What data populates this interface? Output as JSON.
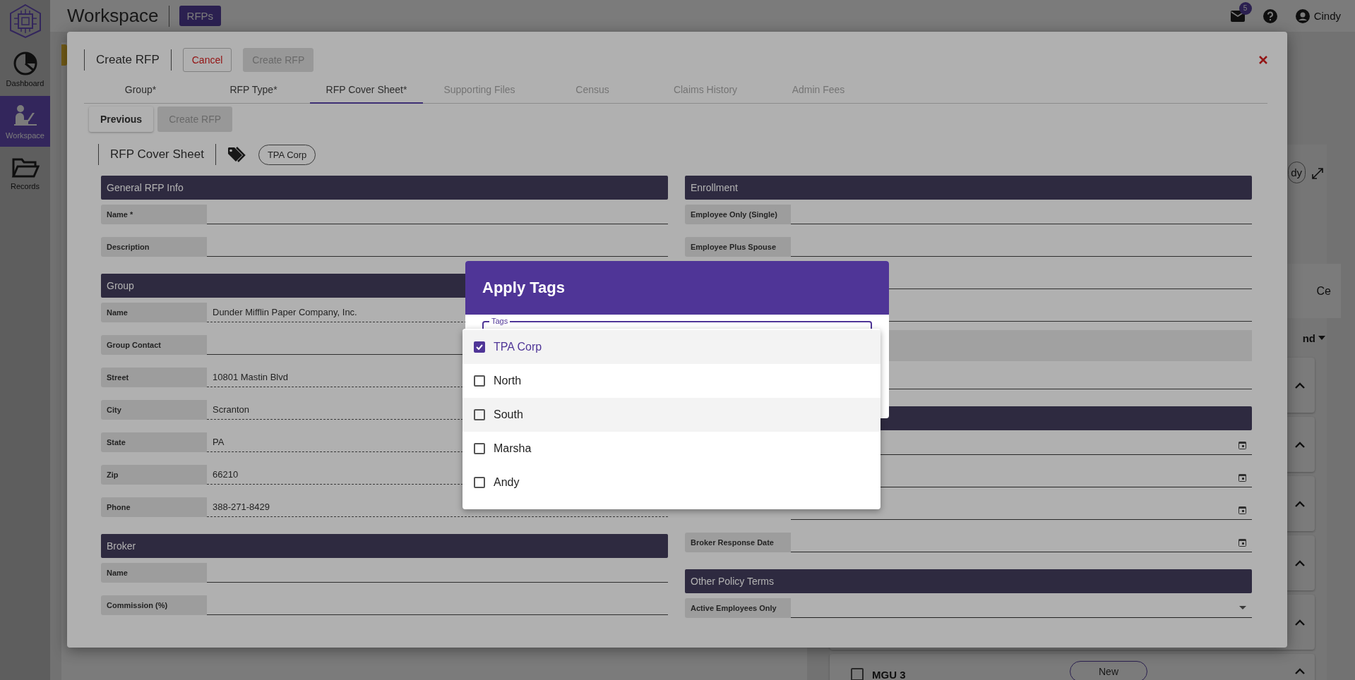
{
  "app": {
    "title": "Workspace",
    "breadcrumb": "RFPs",
    "notification_count": "5",
    "user": "Cindy",
    "nav": [
      {
        "label": "Dashboard",
        "selected": false
      },
      {
        "label": "Workspace",
        "selected": true
      },
      {
        "label": "Records",
        "selected": false
      }
    ],
    "background": {
      "chip": "dy",
      "tab": "Ce",
      "menu": "nd",
      "card": "MGU 3",
      "card_checked": false,
      "button": "New"
    }
  },
  "modal": {
    "title": "Create RFP",
    "actions": [
      {
        "label": "Cancel",
        "kind": "danger",
        "disabled": false
      },
      {
        "label": "Create RFP",
        "kind": "primary",
        "disabled": true
      }
    ],
    "tabs": [
      {
        "label": "Group*",
        "selected": false,
        "disabled": false
      },
      {
        "label": "RFP Type*",
        "selected": false,
        "disabled": false
      },
      {
        "label": "RFP Cover Sheet*",
        "selected": true,
        "disabled": false
      },
      {
        "label": "Supporting Files",
        "selected": false,
        "disabled": true
      },
      {
        "label": "Census",
        "selected": false,
        "disabled": true
      },
      {
        "label": "Claims History",
        "selected": false,
        "disabled": true
      },
      {
        "label": "Admin Fees",
        "selected": false,
        "disabled": true
      }
    ],
    "steps": [
      {
        "label": "Previous",
        "disabled": false
      },
      {
        "label": "Create RFP",
        "disabled": true
      }
    ],
    "sheet_title": "RFP Cover Sheet",
    "tags": [
      "TPA Corp"
    ],
    "left_sections": [
      {
        "title": "General RFP Info",
        "fields": [
          {
            "label": "Name *",
            "kind": "text"
          },
          {
            "label": "Description",
            "kind": "text"
          }
        ]
      },
      {
        "title": "Group",
        "fields": [
          {
            "label": "Name",
            "value": "Dunder Mifflin Paper Company, Inc.",
            "kind": "text"
          },
          {
            "label": "Group Contact",
            "kind": "text"
          },
          {
            "label": "Street",
            "value": "10801 Mastin Blvd",
            "kind": "text"
          },
          {
            "label": "City",
            "value": "Scranton",
            "kind": "text"
          },
          {
            "label": "State",
            "value": "PA",
            "kind": "text"
          },
          {
            "label": "Zip",
            "value": "66210",
            "kind": "text"
          },
          {
            "label": "Phone",
            "value": "388-271-8429",
            "kind": "text"
          }
        ]
      },
      {
        "title": "Broker",
        "fields": [
          {
            "label": "Name",
            "kind": "text"
          },
          {
            "label": "Commission (%)",
            "kind": "text"
          }
        ]
      }
    ],
    "right_sections": [
      {
        "title": "Enrollment",
        "fields": [
          {
            "label": "Employee Only (Single)",
            "kind": "text"
          },
          {
            "label": "Employee Plus Spouse",
            "kind": "text"
          },
          {
            "kind": "text"
          },
          {
            "kind": "text"
          },
          {
            "kind": "band"
          },
          {
            "kind": "text"
          }
        ]
      },
      {
        "fields": [
          {
            "kind": "date"
          },
          {
            "kind": "date"
          },
          {
            "kind": "date"
          },
          {
            "label": "Broker Response Date",
            "kind": "date"
          }
        ]
      },
      {
        "title": "Other Policy Terms",
        "fields": [
          {
            "label": "Active Employees Only",
            "kind": "select"
          }
        ]
      }
    ]
  },
  "dialog": {
    "title": "Apply Tags",
    "field_label": "Tags",
    "options": [
      {
        "label": "TPA Corp",
        "checked": true,
        "hovered": false
      },
      {
        "label": "North",
        "checked": false,
        "hovered": false
      },
      {
        "label": "South",
        "checked": false,
        "hovered": true
      },
      {
        "label": "Marsha",
        "checked": false,
        "hovered": false
      },
      {
        "label": "Andy",
        "checked": false,
        "hovered": false
      }
    ]
  }
}
